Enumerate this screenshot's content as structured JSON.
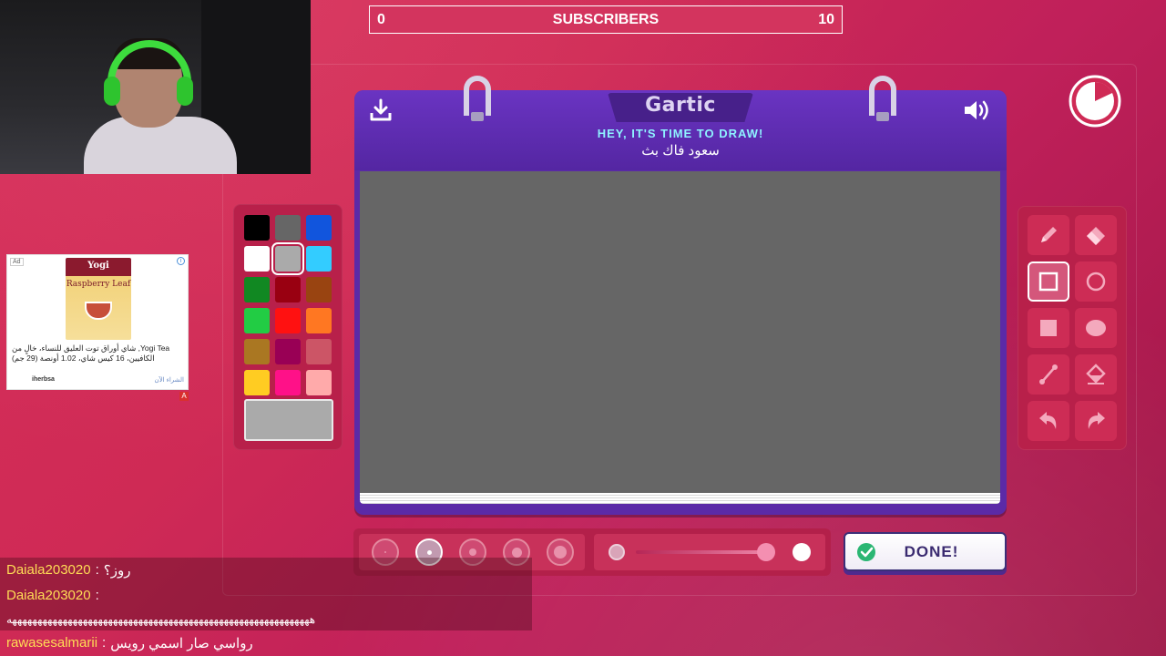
{
  "scoreboard": {
    "left_value": "0",
    "title": "SUBSCRIBERS",
    "right_value": "10"
  },
  "notebook": {
    "logo": "Gartic",
    "message": "HEY, IT'S TIME TO DRAW!",
    "word": "سعود فاك بث"
  },
  "palette": {
    "selected_color": "#aaaaaa",
    "colors": [
      "#000000",
      "#666666",
      "#1155dd",
      "#ffffff",
      "#aaaaaa",
      "#33ccff",
      "#118822",
      "#990011",
      "#994411",
      "#22cc44",
      "#ff1111",
      "#ff7722",
      "#aa7722",
      "#990055",
      "#cc5566",
      "#ffcc22",
      "#ff1188",
      "#ffaaaa"
    ]
  },
  "tools": {
    "items": [
      "pencil-icon",
      "eraser-icon",
      "rectangle-outline-icon",
      "ellipse-outline-icon",
      "rectangle-filled-icon",
      "ellipse-filled-icon",
      "line-icon",
      "fill-bucket-icon",
      "undo-icon",
      "redo-icon"
    ],
    "active": "rectangle-outline-icon"
  },
  "brush": {
    "sizes": 5,
    "selected_size_index": 1,
    "opacity_fraction": 0.95
  },
  "done_label": "DONE!",
  "ad": {
    "badge": "Ad",
    "product_brand": "Yogi",
    "product_flavor": "Raspberry Leaf",
    "text": "Yogi Tea, شاي أوراق توت العليق للنساء، خالٍ من الكافيين، 16 كيس شاي، 1.02 أونصة (29 جم)",
    "source": "iherbsa",
    "cta": "الشراء الآن",
    "info": "i",
    "flag": "A"
  },
  "chat": {
    "messages": [
      {
        "user": "Daiala203020",
        "text": "روز؟"
      },
      {
        "user": "Daiala203020",
        "text": ""
      },
      {
        "user": "",
        "text": "ههههههههههههههههههههههههههههههههههههههههههههههههههههههههههههه"
      },
      {
        "user": "rawasesalmarii",
        "text": "رواسي صار اسمي رويس"
      }
    ]
  },
  "colors": {
    "background": "#cf2a55",
    "notebook": "#5b2aa7",
    "canvas": "#666666",
    "message": "#8ef2ff",
    "chat_user": "#ffdd55"
  }
}
